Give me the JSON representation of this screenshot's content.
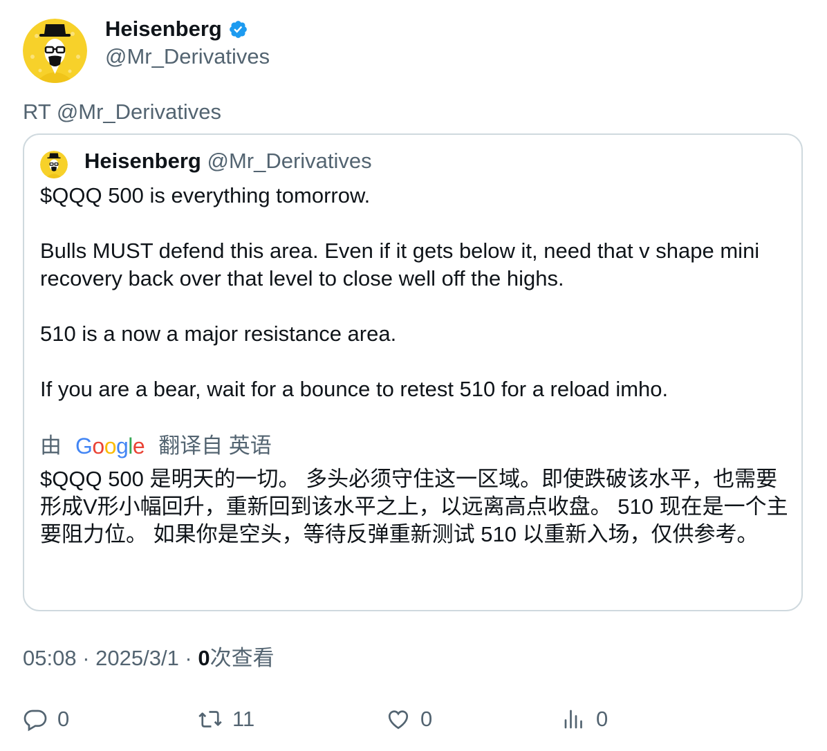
{
  "author": {
    "display_name": "Heisenberg",
    "handle": "@Mr_Derivatives",
    "avatar_icon": "heisenberg-avatar",
    "verified_color": "#1d9bf0"
  },
  "retweet_label": "RT @Mr_Derivatives",
  "quoted": {
    "display_name": "Heisenberg",
    "handle": "@Mr_Derivatives",
    "paragraphs": [
      "$QQQ 500 is everything tomorrow.",
      "Bulls MUST defend this area. Even if it gets below it, need that v shape mini recovery back over that level to close well off the highs.",
      "510 is a now a major resistance area.",
      "If you are a bear, wait for a bounce to retest 510 for a reload imho."
    ],
    "translation": {
      "prefix": "由",
      "provider": "Google",
      "suffix": "翻译自 英语",
      "text": "$QQQ 500 是明天的一切。 多头必须守住这一区域。即使跌破该水平，也需要形成V形小幅回升，重新回到该水平之上，以远离高点收盘。 510 现在是一个主要阻力位。 如果你是空头，等待反弹重新测试 510 以重新入场，仅供参考。"
    }
  },
  "meta": {
    "time": "05:08",
    "date": "2025/3/1",
    "views": "0",
    "views_label": "次查看"
  },
  "actions": {
    "reply_count": "0",
    "retweet_count": "11",
    "like_count": "0",
    "views_count": "0"
  }
}
